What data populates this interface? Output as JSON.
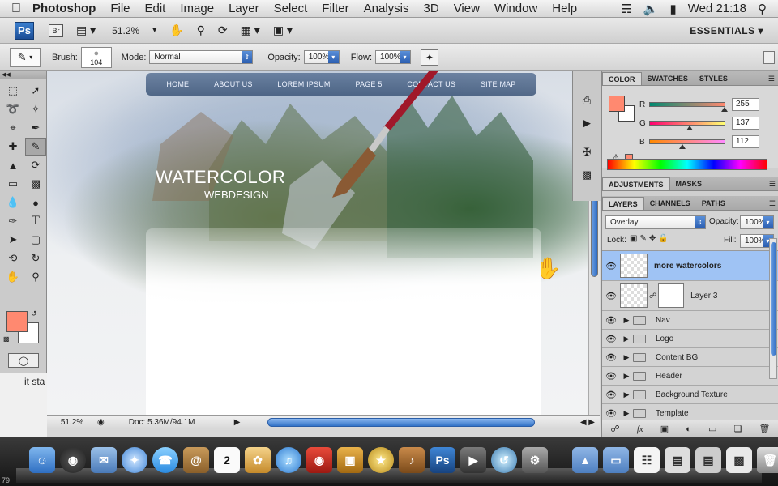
{
  "menubar": {
    "app": "Photoshop",
    "items": [
      "File",
      "Edit",
      "Image",
      "Layer",
      "Select",
      "Filter",
      "Analysis",
      "3D",
      "View",
      "Window",
      "Help"
    ],
    "clock": "Wed 21:18"
  },
  "appbar": {
    "ps_label": "Ps",
    "br_label": "Br",
    "zoom": "51.2%",
    "workspace": "ESSENTIALS ▾"
  },
  "options": {
    "brush_label": "Brush:",
    "brush_size": "104",
    "mode_label": "Mode:",
    "mode_value": "Normal",
    "opacity_label": "Opacity:",
    "opacity_value": "100%",
    "flow_label": "Flow:",
    "flow_value": "100%"
  },
  "canvas": {
    "nav": [
      "HOME",
      "ABOUT US",
      "LOREM IPSUM",
      "PAGE 5",
      "CONTACT US",
      "SITE MAP"
    ],
    "title": "WATERCOLOR",
    "subtitle": "WEBDESIGN"
  },
  "status": {
    "zoom": "51.2%",
    "doc": "Doc: 5.36M/94.1M"
  },
  "below_tools_text": "it sta",
  "color_panel": {
    "tabs": [
      "COLOR",
      "SWATCHES",
      "STYLES"
    ],
    "active_tab": "COLOR",
    "channels": [
      {
        "name": "R",
        "value": "255",
        "level": 1.0
      },
      {
        "name": "G",
        "value": "137",
        "level": 0.537
      },
      {
        "name": "B",
        "value": "112",
        "level": 0.439
      }
    ],
    "foreground": "#ff8970"
  },
  "adjust_panel": {
    "tabs": [
      "ADJUSTMENTS",
      "MASKS"
    ]
  },
  "layers_panel": {
    "tabs": [
      "LAYERS",
      "CHANNELS",
      "PATHS"
    ],
    "blend_mode": "Overlay",
    "opacity_label": "Opacity:",
    "opacity_value": "100%",
    "lock_label": "Lock:",
    "fill_label": "Fill:",
    "fill_value": "100%",
    "layers": [
      {
        "name": "more watercolors",
        "kind": "layer",
        "selected": true
      },
      {
        "name": "Layer 3",
        "kind": "masked"
      },
      {
        "name": "Nav",
        "kind": "group"
      },
      {
        "name": "Logo",
        "kind": "group"
      },
      {
        "name": "Content BG",
        "kind": "group"
      },
      {
        "name": "Header",
        "kind": "group"
      },
      {
        "name": "Background Texture",
        "kind": "group"
      },
      {
        "name": "Template",
        "kind": "group"
      }
    ]
  },
  "dock": {
    "calendar_day": "2",
    "photoshop_label": "Ps",
    "corner_text": "79"
  }
}
